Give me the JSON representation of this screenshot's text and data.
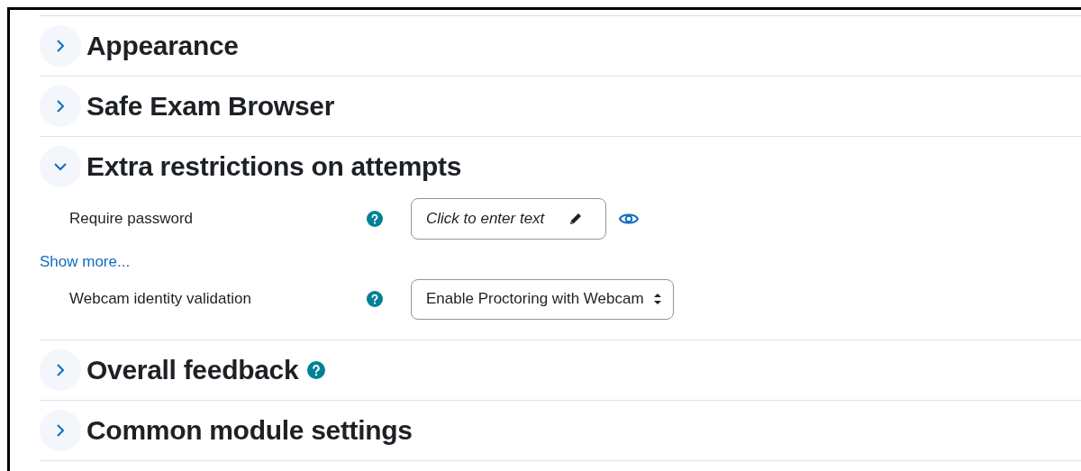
{
  "sections": [
    {
      "title": "Appearance",
      "expanded": false
    },
    {
      "title": "Safe Exam Browser",
      "expanded": false
    },
    {
      "title": "Extra restrictions on attempts",
      "expanded": true,
      "items": [
        {
          "kind": "editable",
          "label": "Require password",
          "help": true,
          "placeholder": "Click to enter text",
          "reveal": true
        },
        {
          "kind": "link",
          "text": "Show more..."
        },
        {
          "kind": "select",
          "label": "Webcam identity validation",
          "help": true,
          "value": "Enable Proctoring with Webcam"
        }
      ]
    },
    {
      "title": "Overall feedback",
      "expanded": false,
      "help": true
    },
    {
      "title": "Common module settings",
      "expanded": false
    }
  ]
}
